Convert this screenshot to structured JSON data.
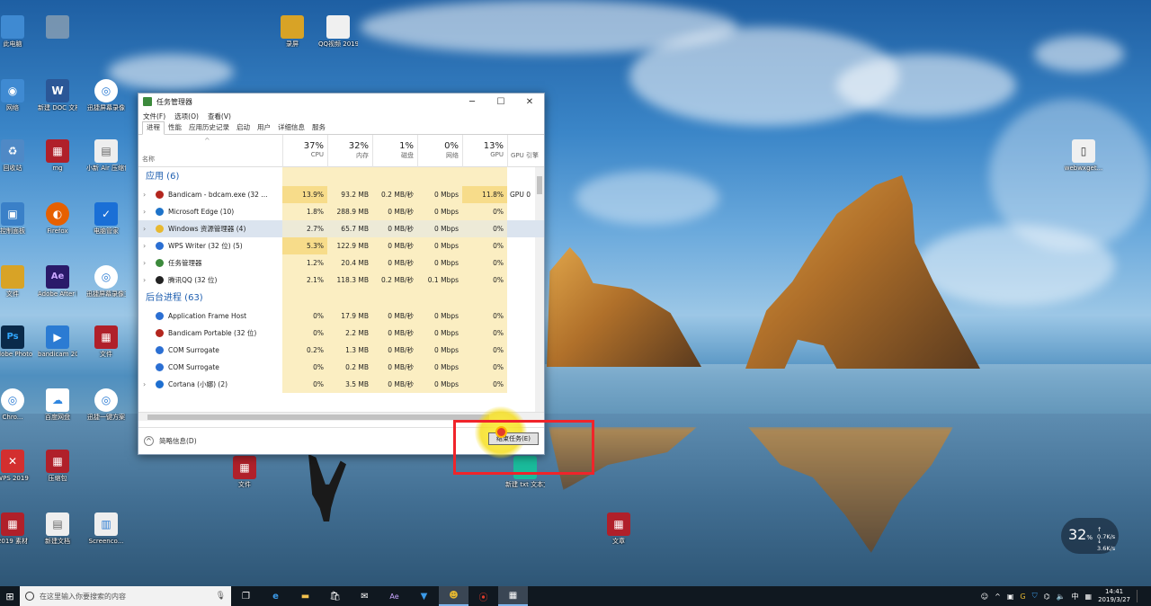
{
  "desktop": {
    "icons": [
      {
        "label": "此电脑",
        "color": "#3f8ad2",
        "glyph": "▭"
      },
      {
        "label": "",
        "color": "#8899aa",
        "glyph": ""
      },
      {
        "label": "网络",
        "color": "#3f8ad2",
        "glyph": "◉"
      },
      {
        "label": "新建 DOC 文档",
        "color": "#2b5797",
        "glyph": "W"
      },
      {
        "label": "迅捷屏幕录像",
        "color": "#2b7bd3",
        "glyph": "◎"
      },
      {
        "label": "回收站",
        "color": "#4f89c6",
        "glyph": "♻"
      },
      {
        "label": "mg",
        "color": "#b0202a",
        "glyph": "▦"
      },
      {
        "label": "小新 Air 压缩包",
        "color": "#eeeeee",
        "glyph": "▤"
      },
      {
        "label": "控制面板",
        "color": "#3a80c8",
        "glyph": "▣"
      },
      {
        "label": "Firefox",
        "color": "#e66000",
        "glyph": "◐"
      },
      {
        "label": "电脑管家",
        "color": "#1a6fd6",
        "glyph": "✓"
      },
      {
        "label": "文件",
        "color": "#d8a326",
        "glyph": "▮"
      },
      {
        "label": "Adobe After Effects CC",
        "color": "#2a1a6a",
        "glyph": "Ae"
      },
      {
        "label": "迅捷屏幕录像工具",
        "color": "#2b7bd3",
        "glyph": "◎"
      },
      {
        "label": "Adobe Photo...",
        "color": "#0a2a4a",
        "glyph": "Ps"
      },
      {
        "label": "bandicam 2019-03...",
        "color": "#2b7bd3",
        "glyph": "▶"
      },
      {
        "label": "文件",
        "color": "#b0202a",
        "glyph": "▦"
      },
      {
        "label": "Chro...",
        "color": "#2b7bd3",
        "glyph": "◎"
      },
      {
        "label": "百度网盘",
        "color": "#2f86e0",
        "glyph": "☁"
      },
      {
        "label": "迅捷一键方案",
        "color": "#2b7bd3",
        "glyph": "◎"
      },
      {
        "label": "WPS 2019",
        "color": "#d32f2f",
        "glyph": "✕"
      },
      {
        "label": "压缩包",
        "color": "#b0202a",
        "glyph": "▦"
      },
      {
        "label": "2019 素材",
        "color": "#b0202a",
        "glyph": "▦"
      },
      {
        "label": "新建文档",
        "color": "#eeeeee",
        "glyph": "▤"
      },
      {
        "label": "Screenco...",
        "color": "#eeeeee",
        "glyph": "▥"
      },
      {
        "label": "录屏",
        "color": "#d8a326",
        "glyph": "▮"
      },
      {
        "label": "QQ视频 20190326...",
        "color": "#f0f0f0",
        "glyph": "▯"
      },
      {
        "label": "webwxget...",
        "color": "#f0f0f0",
        "glyph": "▯"
      },
      {
        "label": "文件",
        "color": "#b0202a",
        "glyph": "▦"
      },
      {
        "label": "新建 txt 文本文档",
        "color": "#1abc9c",
        "glyph": "▬"
      },
      {
        "label": "文章",
        "color": "#b0202a",
        "glyph": "▦"
      }
    ]
  },
  "task_manager": {
    "title": "任务管理器",
    "window_buttons": {
      "min": "─",
      "max": "☐",
      "close": "✕"
    },
    "menu": [
      "文件(F)",
      "选项(O)",
      "查看(V)"
    ],
    "tabs": [
      "进程",
      "性能",
      "应用历史记录",
      "启动",
      "用户",
      "详细信息",
      "服务"
    ],
    "active_tab": "进程",
    "columns": {
      "name": "名称",
      "cpu": {
        "pct": "37%",
        "label": "CPU"
      },
      "mem": {
        "pct": "32%",
        "label": "内存"
      },
      "disk": {
        "pct": "1%",
        "label": "磁盘"
      },
      "net": {
        "pct": "0%",
        "label": "网络"
      },
      "gpu": {
        "pct": "13%",
        "label": "GPU"
      },
      "gpu_engine": {
        "label": "GPU 引擎"
      }
    },
    "groups": [
      {
        "title": "应用 (6)",
        "rows": [
          {
            "name": "Bandicam - bdcam.exe (32 ...",
            "icon_color": "#b3261e",
            "cpu": "13.9%",
            "mem": "93.2 MB",
            "disk": "0.2 MB/秒",
            "net": "0 Mbps",
            "gpu": "11.8%",
            "gpu_engine": "GPU 0",
            "expand": true
          },
          {
            "name": "Microsoft Edge (10)",
            "icon_color": "#1e73c9",
            "cpu": "1.8%",
            "mem": "288.9 MB",
            "disk": "0 MB/秒",
            "net": "0 Mbps",
            "gpu": "0%",
            "gpu_engine": "",
            "expand": true
          },
          {
            "name": "Windows 资源管理器 (4)",
            "icon_color": "#e8b930",
            "cpu": "2.7%",
            "mem": "65.7 MB",
            "disk": "0 MB/秒",
            "net": "0 Mbps",
            "gpu": "0%",
            "gpu_engine": "",
            "expand": true,
            "selected": true
          },
          {
            "name": "WPS Writer (32 位) (5)",
            "icon_color": "#2b6fd3",
            "cpu": "5.3%",
            "mem": "122.9 MB",
            "disk": "0 MB/秒",
            "net": "0 Mbps",
            "gpu": "0%",
            "gpu_engine": "",
            "expand": true
          },
          {
            "name": "任务管理器",
            "icon_color": "#3c8a3c",
            "cpu": "1.2%",
            "mem": "20.4 MB",
            "disk": "0 MB/秒",
            "net": "0 Mbps",
            "gpu": "0%",
            "gpu_engine": "",
            "expand": true
          },
          {
            "name": "腾讯QQ (32 位)",
            "icon_color": "#222222",
            "cpu": "2.1%",
            "mem": "118.3 MB",
            "disk": "0.2 MB/秒",
            "net": "0.1 Mbps",
            "gpu": "0%",
            "gpu_engine": "",
            "expand": true
          }
        ]
      },
      {
        "title": "后台进程 (63)",
        "rows": [
          {
            "name": "Application Frame Host",
            "icon_color": "#2b6fd3",
            "cpu": "0%",
            "mem": "17.9 MB",
            "disk": "0 MB/秒",
            "net": "0 Mbps",
            "gpu": "0%",
            "gpu_engine": "",
            "expand": false
          },
          {
            "name": "Bandicam Portable (32 位)",
            "icon_color": "#b3261e",
            "cpu": "0%",
            "mem": "2.2 MB",
            "disk": "0 MB/秒",
            "net": "0 Mbps",
            "gpu": "0%",
            "gpu_engine": "",
            "expand": false
          },
          {
            "name": "COM Surrogate",
            "icon_color": "#2b6fd3",
            "cpu": "0.2%",
            "mem": "1.3 MB",
            "disk": "0 MB/秒",
            "net": "0 Mbps",
            "gpu": "0%",
            "gpu_engine": "",
            "expand": false
          },
          {
            "name": "COM Surrogate",
            "icon_color": "#2b6fd3",
            "cpu": "0%",
            "mem": "0.2 MB",
            "disk": "0 MB/秒",
            "net": "0 Mbps",
            "gpu": "0%",
            "gpu_engine": "",
            "expand": false
          },
          {
            "name": "Cortana (小娜) (2)",
            "icon_color": "#1e6fd0",
            "cpu": "0%",
            "mem": "3.5 MB",
            "disk": "0 MB/秒",
            "net": "0 Mbps",
            "gpu": "0%",
            "gpu_engine": "",
            "expand": true
          }
        ]
      }
    ],
    "footer_label": "简略信息(D)",
    "end_task_label": "结束任务(E)"
  },
  "speed_widget": {
    "percent": "32",
    "percent_unit": "%",
    "up": "0.7K/s",
    "down": "3.6K/s"
  },
  "taskbar": {
    "search_placeholder": "在这里输入你要搜索的内容",
    "apps": [
      "task-view",
      "edge",
      "file-explorer",
      "store",
      "mail",
      "after-effects",
      "qq-browser",
      "bandicam-portable",
      "bandicam",
      "task-manager"
    ],
    "time": "14:41",
    "date": "2019/3/27",
    "ime": "中"
  }
}
